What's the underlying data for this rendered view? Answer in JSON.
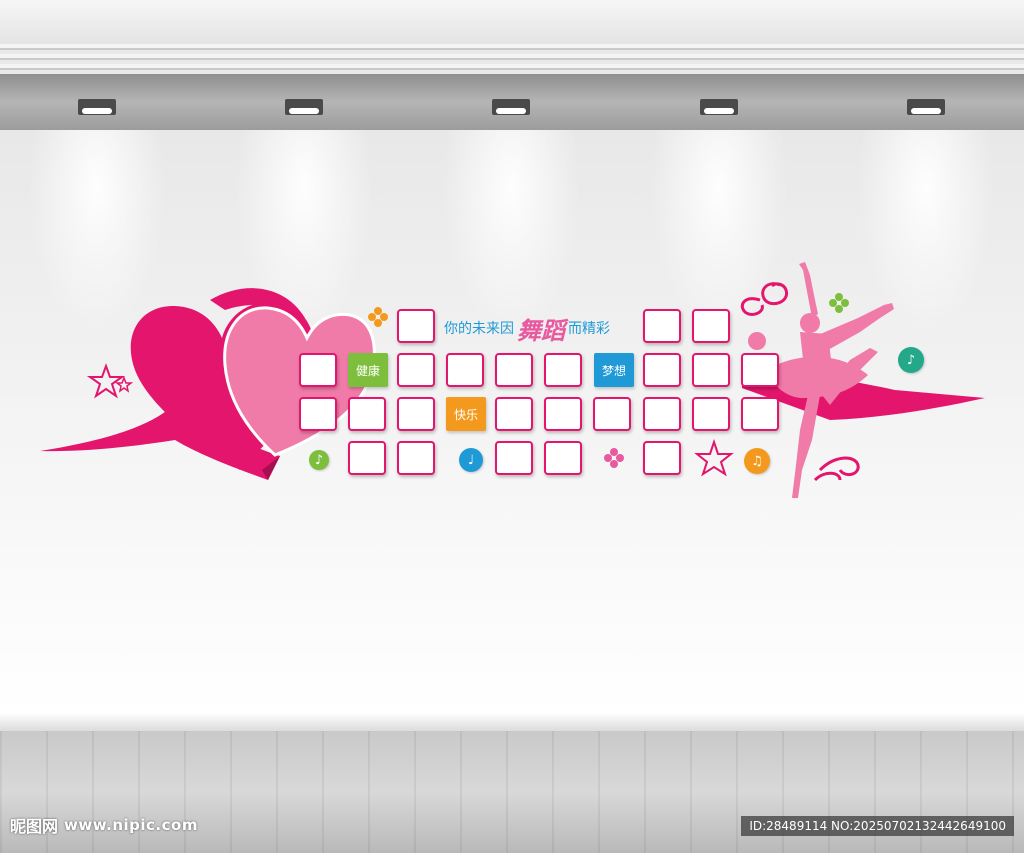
{
  "slogan": {
    "part1": "你的未来因",
    "part2": "舞蹈",
    "part3": "而精彩"
  },
  "tiles": {
    "health": "健康",
    "dream": "梦想",
    "happy": "快乐"
  },
  "colors": {
    "magenta": "#e3156d",
    "pink": "#f07aa8",
    "blue": "#1f9ad6",
    "green": "#7dbf3d",
    "orange": "#f39a1e"
  },
  "icons": [
    "music-note-icon",
    "star-icon",
    "flower-icon",
    "dancer-silhouette",
    "heart-icon"
  ],
  "watermark": {
    "brand": "昵图网",
    "url": "www.nipic.com",
    "id": "ID:28489114 NO:20250702132442649100"
  }
}
